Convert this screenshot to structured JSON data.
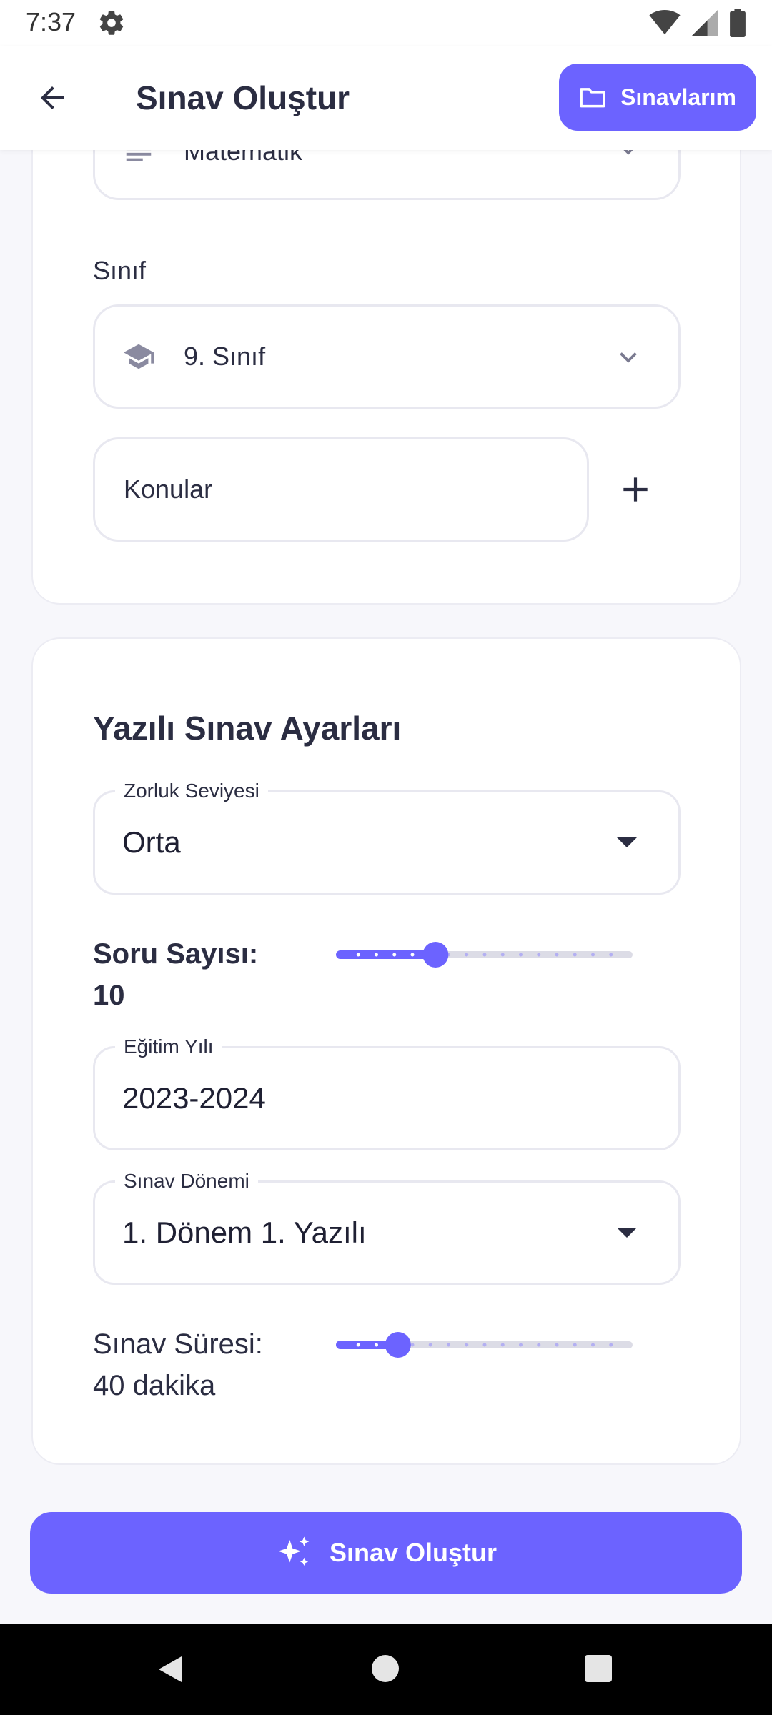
{
  "status_bar": {
    "time": "7:37"
  },
  "app_bar": {
    "title": "Sınav Oluştur",
    "my_exams_label": "Sınavlarım"
  },
  "subject_select": {
    "value": "Matematik"
  },
  "class_section": {
    "label": "Sınıf",
    "value": "9. Sınıf"
  },
  "topics_input": {
    "placeholder": "Konular"
  },
  "settings": {
    "title": "Yazılı Sınav Ayarları",
    "difficulty": {
      "label": "Zorluk Seviyesi",
      "value": "Orta"
    },
    "question_count": {
      "label": "Soru Sayısı:",
      "value": "10",
      "slider_fraction": 0.33
    },
    "education_year": {
      "label": "Eğitim Yılı",
      "value": "2023-2024"
    },
    "exam_term": {
      "label": "Sınav Dönemi",
      "value": "1. Dönem 1. Yazılı"
    },
    "duration": {
      "label": "Sınav Süresi:",
      "value": "40 dakika",
      "slider_fraction": 0.2
    }
  },
  "create_button_label": "Sınav Oluştur",
  "colors": {
    "accent": "#6c63ff",
    "slider_inactive": "#dcdce6",
    "background": "#f7f7fb"
  }
}
